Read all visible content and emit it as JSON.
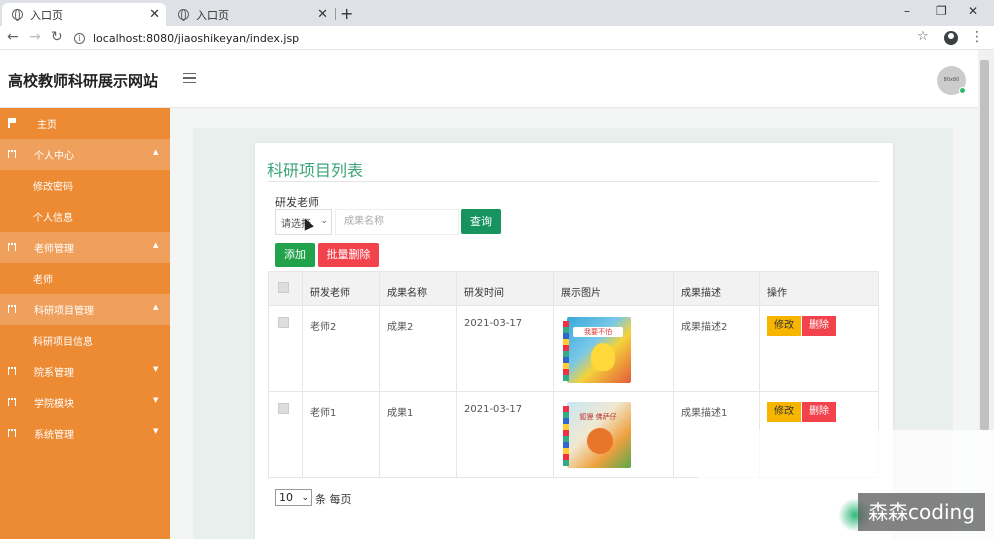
{
  "browser": {
    "tabs": [
      {
        "title": "入口页",
        "active": true
      },
      {
        "title": "入口页",
        "active": false
      }
    ],
    "url": "localhost:8080/jiaoshikeyan/index.jsp",
    "win_min": "–",
    "win_restore": "❐",
    "win_close": "✕"
  },
  "header": {
    "brand": "高校教师科研展示网站",
    "avatar_text": "80x80"
  },
  "sidebar": {
    "items": [
      {
        "label": "主页",
        "type": "top",
        "icon": "flag-icon"
      },
      {
        "label": "个人中心",
        "type": "group",
        "icon": "grid-icon",
        "caret": "▲"
      },
      {
        "label": "修改密码",
        "type": "sub"
      },
      {
        "label": "个人信息",
        "type": "sub"
      },
      {
        "label": "老师管理",
        "type": "group",
        "icon": "grid-icon",
        "caret": "▲"
      },
      {
        "label": "老师",
        "type": "sub"
      },
      {
        "label": "科研项目管理",
        "type": "group",
        "icon": "grid-icon",
        "caret": "▲"
      },
      {
        "label": "科研项目信息",
        "type": "sub"
      },
      {
        "label": "院系管理",
        "type": "group",
        "icon": "grid-icon",
        "caret": "▼"
      },
      {
        "label": "学院模块",
        "type": "group",
        "icon": "grid-icon",
        "caret": "▼"
      },
      {
        "label": "系统管理",
        "type": "group",
        "icon": "grid-icon",
        "caret": "▼"
      }
    ]
  },
  "main": {
    "title": "科研项目列表",
    "filter_label": "研发老师",
    "select_value": "请选择",
    "search_placeholder": "成果名称",
    "query_btn": "查询",
    "add_btn": "添加",
    "batch_delete_btn": "批量删除",
    "table": {
      "headers": [
        "研发老师",
        "成果名称",
        "研发时间",
        "展示图片",
        "成果描述",
        "操作"
      ],
      "rows": [
        {
          "teacher": "老师2",
          "name": "成果2",
          "date": "2021-03-17",
          "image_caption": "我要不怕",
          "desc": "成果描述2",
          "edit": "修改",
          "delete": "删除"
        },
        {
          "teacher": "老师1",
          "name": "成果1",
          "date": "2021-03-17",
          "image_caption": "狐狸 佛萨仔",
          "desc": "成果描述1",
          "edit": "修改",
          "delete": "删除"
        }
      ]
    },
    "page_size": "10",
    "page_size_suffix": "条 每页"
  },
  "watermark": "森森coding",
  "colors": {
    "sidebar": "#ed8b35",
    "accent_green": "#16935f",
    "danger": "#f2434c",
    "warning": "#f7b500"
  }
}
